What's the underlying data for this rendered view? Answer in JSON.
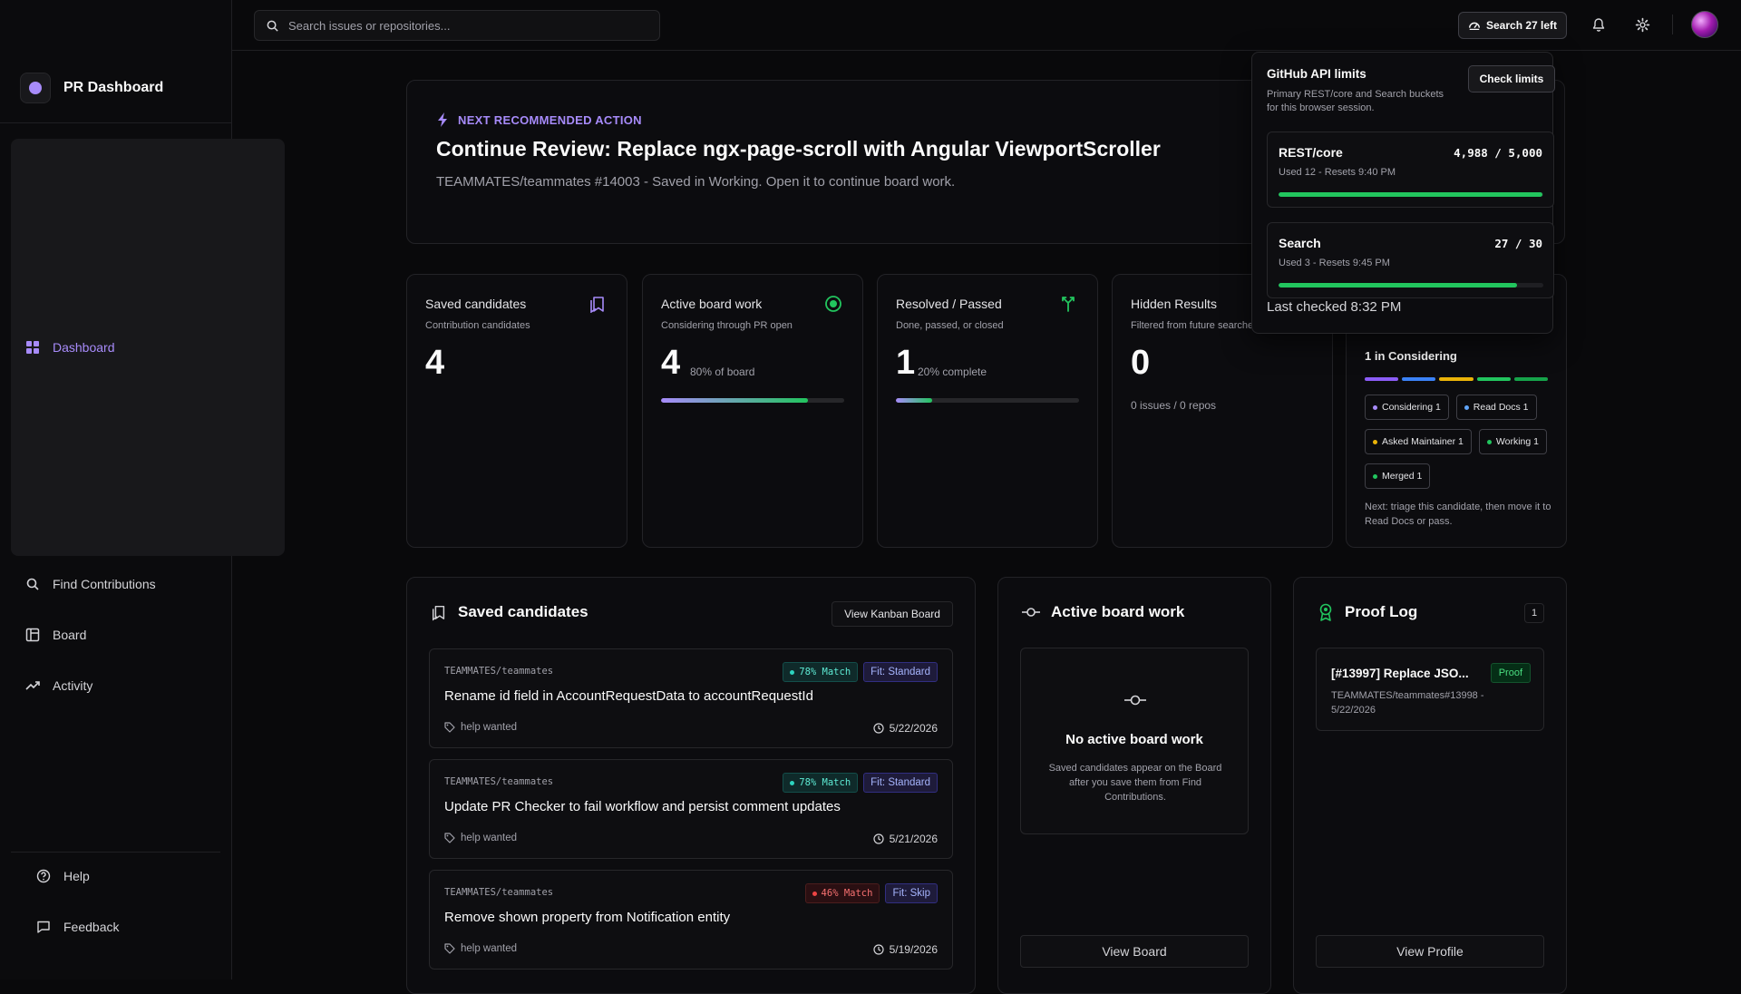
{
  "app": {
    "title": "PR Dashboard"
  },
  "sidebar": {
    "items": [
      {
        "label": "Dashboard",
        "icon": "grid-icon",
        "active": true
      },
      {
        "label": "Find Contributions",
        "icon": "search-icon"
      },
      {
        "label": "Board",
        "icon": "board-icon"
      },
      {
        "label": "Activity",
        "icon": "trend-icon"
      }
    ],
    "bottom": [
      {
        "label": "Help",
        "icon": "help-icon"
      },
      {
        "label": "Feedback",
        "icon": "feedback-icon"
      }
    ]
  },
  "topbar": {
    "search_placeholder": "Search issues or repositories...",
    "quota_label": "Search 27 left"
  },
  "hero": {
    "tag": "NEXT RECOMMENDED ACTION",
    "title": "Continue Review: Replace ngx-page-scroll with Angular ViewportScroller",
    "subtitle": "TEAMMATES/teammates #14003 - Saved in Working. Open it to continue board work."
  },
  "stats": [
    {
      "title": "Saved candidates",
      "subtitle": "Contribution candidates",
      "value": "4",
      "pct_label": "",
      "progress": null,
      "footer": "",
      "icon": "bookmark-icon",
      "icon_color": "#a78bfa"
    },
    {
      "title": "Active board work",
      "subtitle": "Considering through PR open",
      "value": "4",
      "pct_label": "80% of board",
      "progress": 0.8,
      "footer": "",
      "icon": "target-icon",
      "icon_color": "#22c55e"
    },
    {
      "title": "Resolved / Passed",
      "subtitle": "Done, passed, or closed",
      "value": "1",
      "pct_label": "20% complete",
      "progress": 0.2,
      "footer": "",
      "icon": "merge-icon",
      "icon_color": "#22c55e"
    },
    {
      "title": "Hidden Results",
      "subtitle": "Filtered from future searches",
      "value": "0",
      "pct_label": "",
      "progress": null,
      "footer": "0 issues / 0 repos",
      "icon": "eye-off-icon",
      "icon_color": "#a1a1aa"
    }
  ],
  "pipeline": {
    "title": "1 in Considering",
    "bar_colors": [
      "#8b5cf6",
      "#3b82f6",
      "#eab308",
      "#22c55e",
      "#16a34a"
    ],
    "chips": [
      {
        "label": "Considering 1",
        "color": "#a78bfa"
      },
      {
        "label": "Read Docs 1",
        "color": "#60a5fa"
      },
      {
        "label": "Asked Maintainer 1",
        "color": "#eab308"
      },
      {
        "label": "Working 1",
        "color": "#22c55e"
      },
      {
        "label": "Merged 1",
        "color": "#22c55e"
      }
    ],
    "next": "Next: triage this candidate, then move it to Read Docs or pass."
  },
  "saved": {
    "title": "Saved candidates",
    "button": "View Kanban Board",
    "items": [
      {
        "repo": "TEAMMATES/teammates",
        "title": "Rename id field in AccountRequestData to accountRequestId",
        "match": "78% Match",
        "match_level": "high",
        "fit": "Fit: Standard",
        "label": "help wanted",
        "date": "5/22/2026"
      },
      {
        "repo": "TEAMMATES/teammates",
        "title": "Update PR Checker to fail workflow and persist comment updates",
        "match": "78% Match",
        "match_level": "high",
        "fit": "Fit: Standard",
        "label": "help wanted",
        "date": "5/21/2026"
      },
      {
        "repo": "TEAMMATES/teammates",
        "title": "Remove shown property from Notification entity",
        "match": "46% Match",
        "match_level": "low",
        "fit": "Fit: Skip",
        "label": "help wanted",
        "date": "5/19/2026"
      }
    ]
  },
  "active": {
    "title": "Active board work",
    "empty_title": "No active board work",
    "empty_sub": "Saved candidates appear on the Board after you save them from Find Contributions.",
    "button": "View Board"
  },
  "proof": {
    "title": "Proof Log",
    "count": "1",
    "item_title": "[#13997] Replace JSO...",
    "item_badge": "Proof",
    "item_sub": "TEAMMATES/teammates#13998 - 5/22/2026",
    "button": "View Profile"
  },
  "api_popover": {
    "title": "GitHub API limits",
    "subtitle": "Primary REST/core and Search buckets for this browser session.",
    "button": "Check limits",
    "limits": [
      {
        "name": "REST/core",
        "value": "4,988 / 5,000",
        "sub": "Used 12 - Resets 9:40 PM",
        "remaining": 0.9976
      },
      {
        "name": "Search",
        "value": "27 / 30",
        "sub": "Used 3 - Resets 9:45 PM",
        "remaining": 0.9
      }
    ],
    "footer": "Last checked 8:32 PM"
  },
  "colors": {
    "accent": "#a78bfa",
    "success": "#22c55e",
    "danger": "#ef4444",
    "background": "#09090b"
  }
}
